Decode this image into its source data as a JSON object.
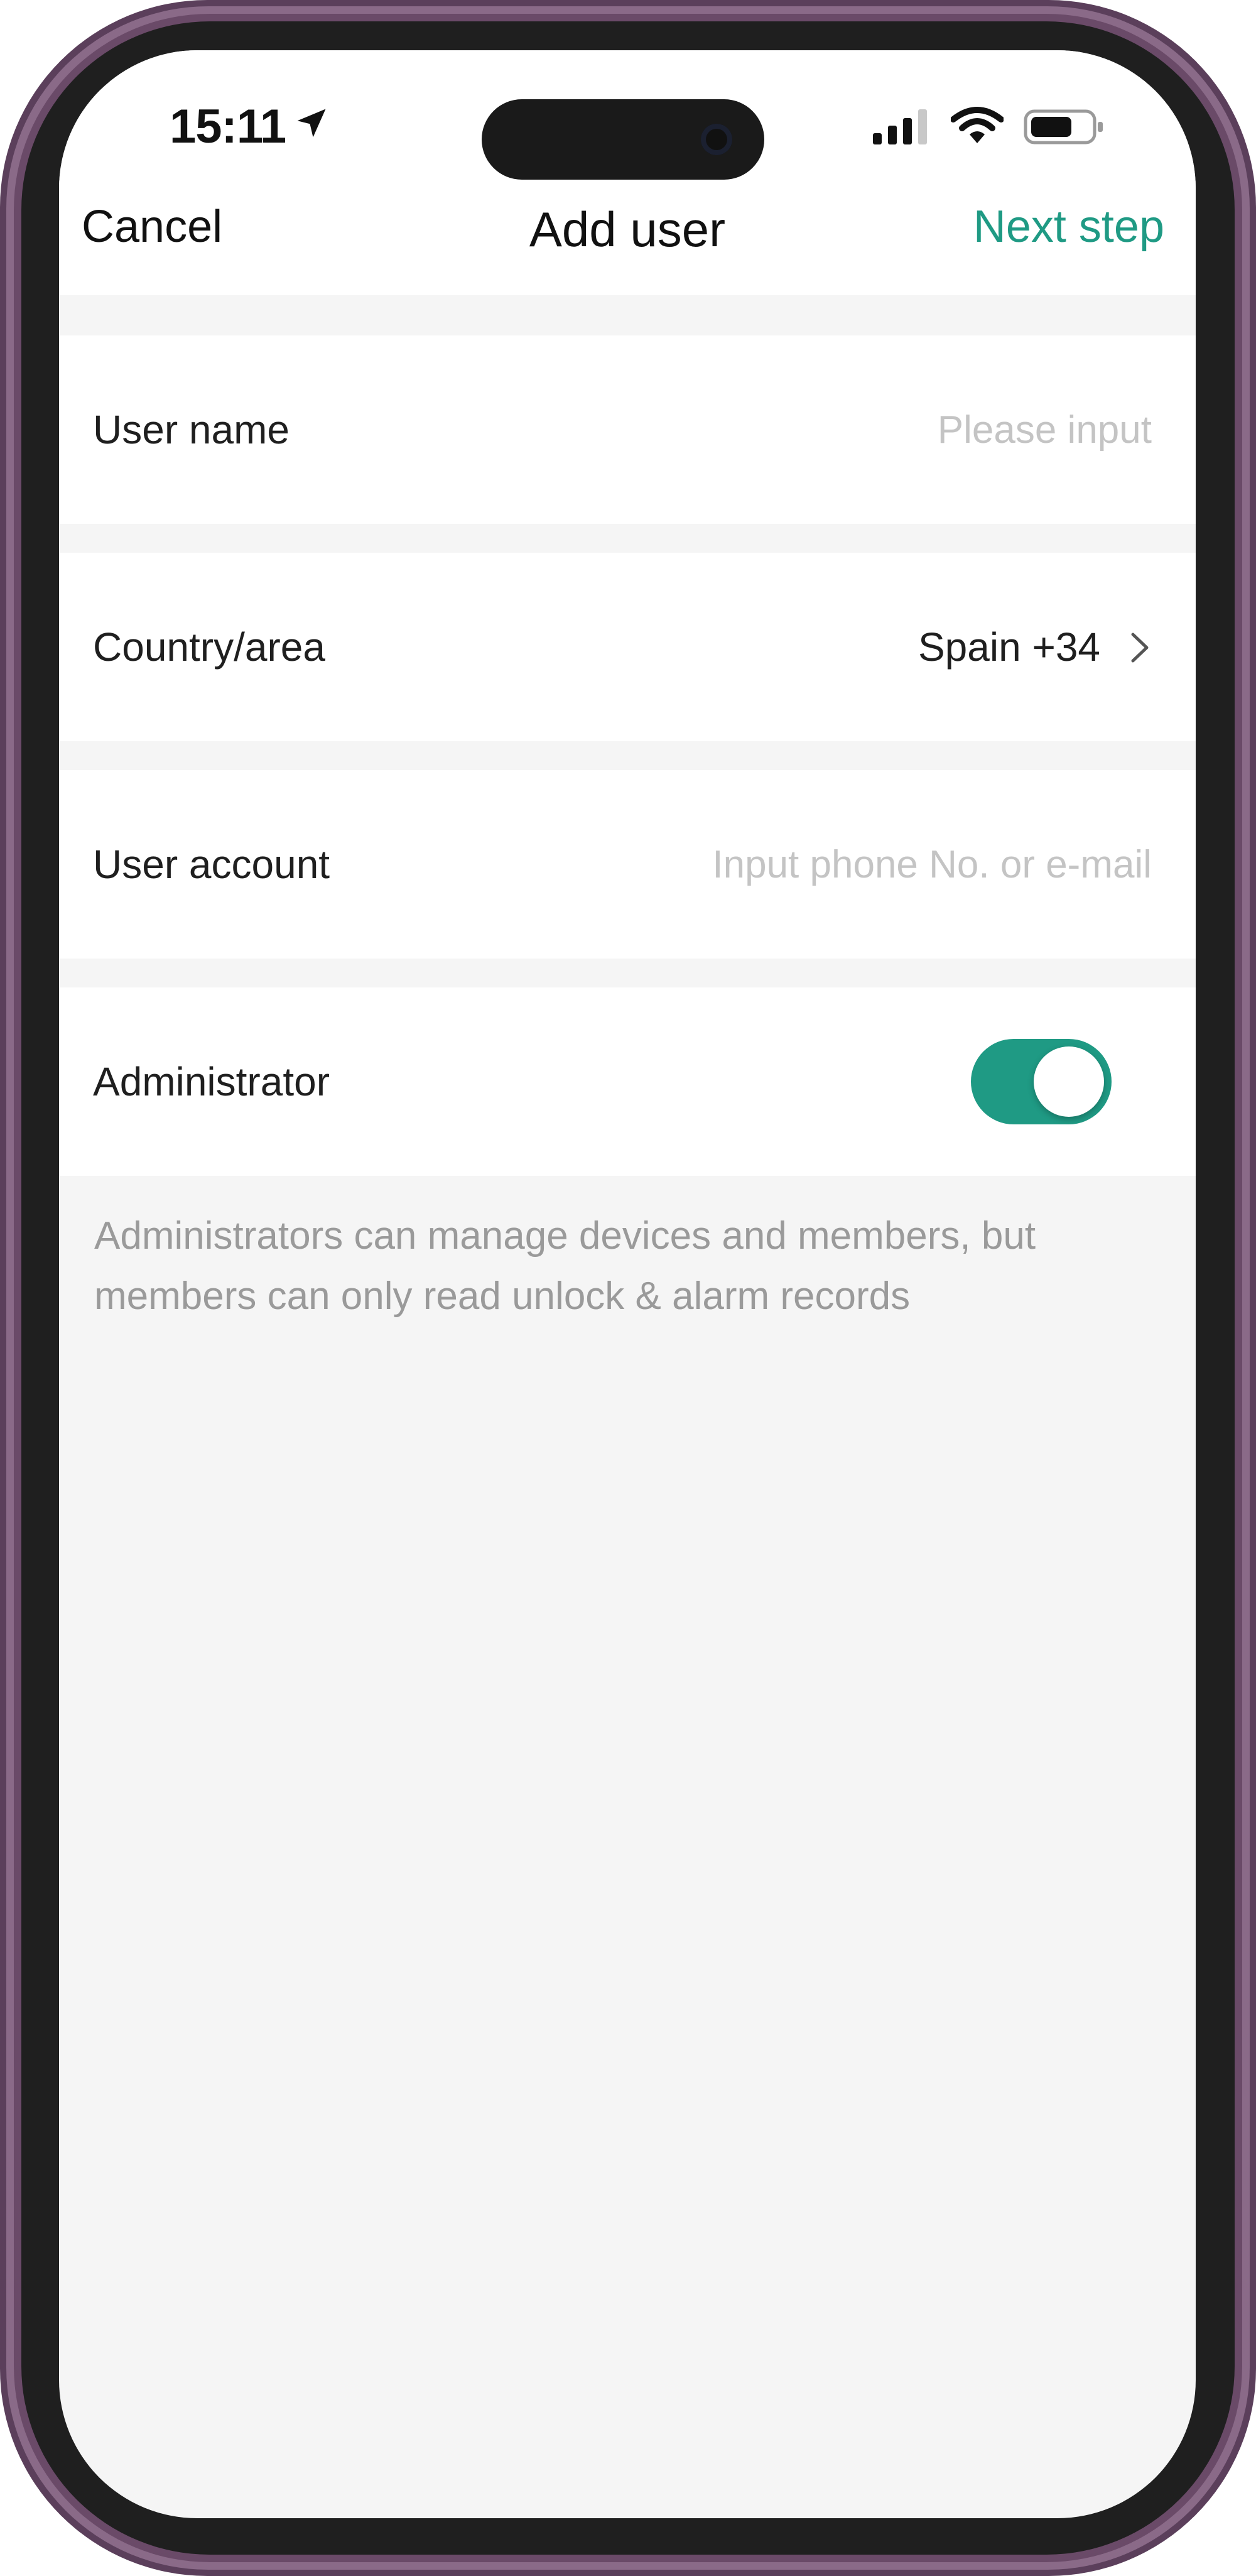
{
  "status_bar": {
    "time": "15:11"
  },
  "nav": {
    "cancel_label": "Cancel",
    "title": "Add user",
    "next_label": "Next step"
  },
  "form": {
    "user_name": {
      "label": "User name",
      "placeholder": "Please input",
      "value": ""
    },
    "country": {
      "label": "Country/area",
      "value": "Spain +34"
    },
    "user_account": {
      "label": "User account",
      "placeholder": "Input phone No. or e-mail",
      "value": ""
    },
    "administrator": {
      "label": "Administrator",
      "enabled": true
    }
  },
  "hint_text": "Administrators can manage devices and members, but members can only read unlock & alarm records",
  "colors": {
    "accent": "#1f9a84",
    "background": "#f5f5f5",
    "frame": "#5b3f5b"
  }
}
